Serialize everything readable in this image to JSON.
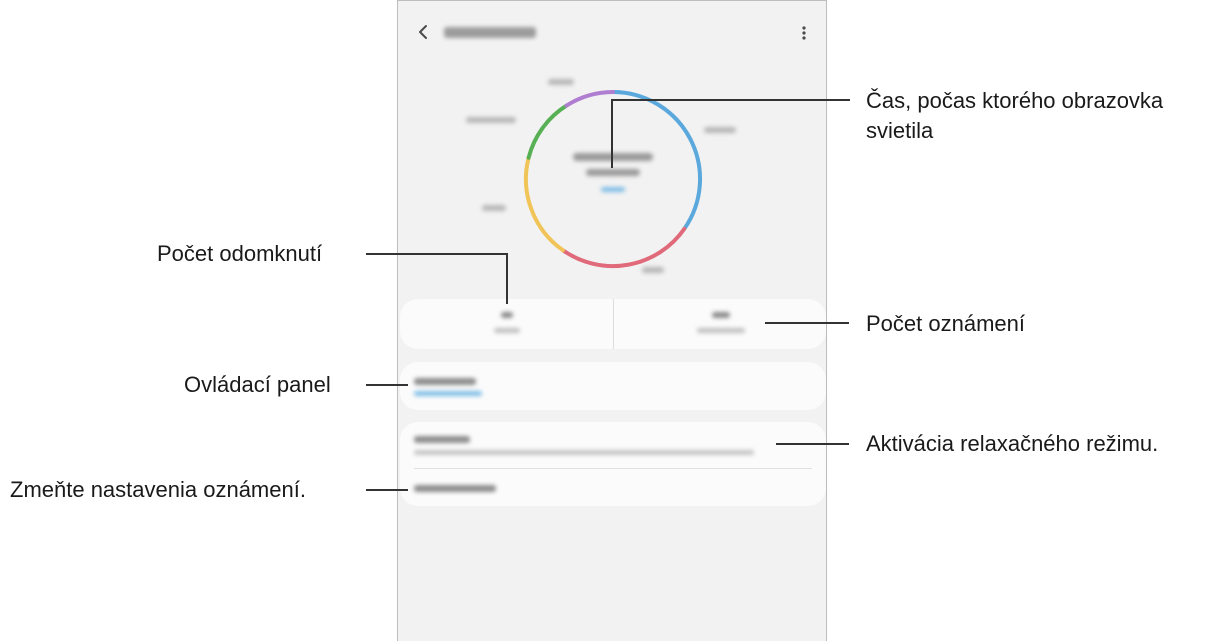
{
  "callouts": {
    "screen_time": {
      "line1": "Čas, počas ktorého obrazovka",
      "line2": "svietila"
    },
    "unlocks": "Počet odomknutí",
    "notifications": "Počet oznámení",
    "dashboard": "Ovládací panel",
    "wind_down": "Aktivácia relaxačného režimu.",
    "notification_settings": "Zmeňte nastavenia oznámení."
  },
  "colors": {
    "accent": "#2aa6df",
    "ring_blue": "#5ba8dd",
    "ring_red": "#e06a7a",
    "ring_yellow": "#f0c457",
    "ring_green": "#58b054",
    "ring_purple": "#b07ed0",
    "phone_bg": "#f2f2f2",
    "card_bg": "#fbfbfb"
  },
  "icons": {
    "back": "chevron-left-icon",
    "more": "more-vertical-icon"
  }
}
